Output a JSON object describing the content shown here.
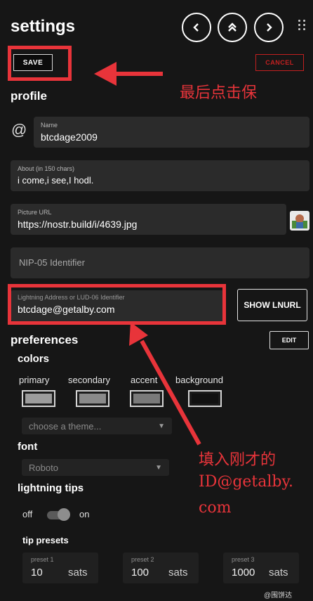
{
  "header": {
    "title": "settings",
    "back_icon": "chevron-left-icon",
    "top_icon": "chevrons-up-icon",
    "forward_icon": "chevron-right-icon",
    "menu_icon": "grid-dots-icon"
  },
  "actions": {
    "save_label": "SAVE",
    "cancel_label": "CANCEL"
  },
  "profile": {
    "title": "profile",
    "name_label": "Name",
    "name_value": "btcdage2009",
    "about_label": "About (in 150 chars)",
    "about_value": "i come,i see,I hodl.",
    "picture_label": "Picture URL",
    "picture_value": "https://nostr.build/i/4639.jpg",
    "nip05_placeholder": "NIP-05 Identifier",
    "lightning_label": "Lightning Address or LUD-06 Identifier",
    "lightning_value": "btcdage@getalby.com",
    "show_lnurl_label": "SHOW LNURL"
  },
  "preferences": {
    "title": "preferences",
    "edit_label": "EDIT",
    "colors_title": "colors",
    "swatches": [
      {
        "label": "primary",
        "color": "#9c9c9c"
      },
      {
        "label": "secondary",
        "color": "#8a8a8a"
      },
      {
        "label": "accent",
        "color": "#7a7a7a"
      },
      {
        "label": "background",
        "color": "#111111"
      }
    ],
    "theme_placeholder": "choose a theme...",
    "font_title": "font",
    "font_value": "Roboto",
    "tips_title": "lightning tips",
    "toggle_off": "off",
    "toggle_on": "on",
    "toggle_state": "on",
    "presets_title": "tip presets",
    "presets": [
      {
        "label": "preset 1",
        "value": "10",
        "unit": "sats"
      },
      {
        "label": "preset 2",
        "value": "100",
        "unit": "sats"
      },
      {
        "label": "preset 3",
        "value": "1000",
        "unit": "sats"
      }
    ]
  },
  "annotations": {
    "save_note": "最后点击保",
    "lightning_note_1": "填入刚才的",
    "lightning_note_2": "ID@getalby.",
    "lightning_note_3": "com",
    "color": "#e8343a"
  },
  "watermark": "@围饼达"
}
